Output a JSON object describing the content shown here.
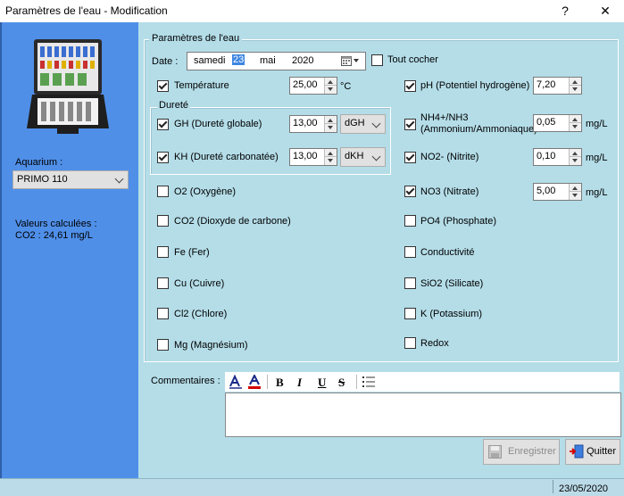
{
  "window": {
    "title": "Paramètres de l'eau - Modification",
    "help_glyph": "?",
    "close_glyph": "✕"
  },
  "sidebar": {
    "aquarium_label": "Aquarium :",
    "aquarium_value": "PRIMO 110",
    "calc_title": "Valeurs calculées :",
    "calc_value": "CO2 : 24,61 mg/L"
  },
  "group": {
    "legend": "Paramètres de l'eau",
    "date_label": "Date :",
    "date": {
      "weekday": "samedi",
      "day": "23",
      "month": "mai",
      "year": "2020"
    },
    "check_all_label": "Tout cocher",
    "durete_legend": "Dureté"
  },
  "params": {
    "temperature": {
      "label": "Température",
      "checked": true,
      "value": "25,00",
      "unit": "°C"
    },
    "gh": {
      "label": "GH (Dureté globale)",
      "checked": true,
      "value": "13,00",
      "unit": "dGH"
    },
    "kh": {
      "label": "KH (Dureté carbonatée)",
      "checked": true,
      "value": "13,00",
      "unit": "dKH"
    },
    "o2": {
      "label": "O2 (Oxygène)",
      "checked": false
    },
    "co2": {
      "label": "CO2 (Dioxyde de carbone)",
      "checked": false
    },
    "fe": {
      "label": "Fe (Fer)",
      "checked": false
    },
    "cu": {
      "label": "Cu (Cuivre)",
      "checked": false
    },
    "cl2": {
      "label": "Cl2 (Chlore)",
      "checked": false
    },
    "mg": {
      "label": "Mg (Magnésium)",
      "checked": false
    },
    "ph": {
      "label": "pH (Potentiel hydrogène)",
      "checked": true,
      "value": "7,20"
    },
    "nh4": {
      "label_1": "NH4+/NH3",
      "label_2": "(Ammonium/Ammoniaque)",
      "checked": true,
      "value": "0,05",
      "unit": "mg/L"
    },
    "no2": {
      "label": "NO2- (Nitrite)",
      "checked": true,
      "value": "0,10",
      "unit": "mg/L"
    },
    "no3": {
      "label": "NO3 (Nitrate)",
      "checked": true,
      "value": "5,00",
      "unit": "mg/L"
    },
    "po4": {
      "label": "PO4 (Phosphate)",
      "checked": false
    },
    "conductivite": {
      "label": "Conductivité",
      "checked": false
    },
    "sio2": {
      "label": "SiO2 (Silicate)",
      "checked": false
    },
    "k": {
      "label": "K (Potassium)",
      "checked": false
    },
    "redox": {
      "label": "Redox",
      "checked": false
    }
  },
  "comments": {
    "label": "Commentaires :",
    "toolbar": {
      "bold": "B",
      "italic": "I",
      "underline": "U",
      "strike": "S"
    },
    "value": ""
  },
  "buttons": {
    "save": "Enregistrer",
    "quit": "Quitter"
  },
  "status": {
    "date": "23/05/2020"
  },
  "colors": {
    "sidebar": "#4f8fe8",
    "content": "#b4dde8",
    "selection": "#3d86e0",
    "font_red": "#d40000"
  }
}
